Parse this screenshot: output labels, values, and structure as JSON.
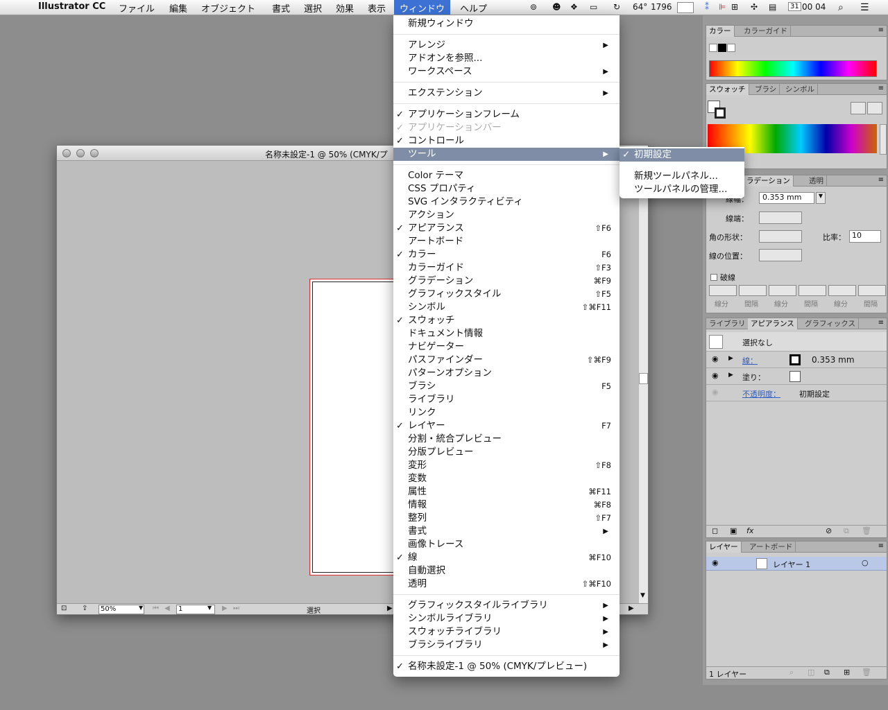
{
  "menubar": {
    "app": "Illustrator CC",
    "menus": [
      "ファイル",
      "編集",
      "オブジェクト",
      "書式",
      "選択",
      "効果",
      "表示",
      "ウィンドウ",
      "ヘルプ"
    ],
    "active_menu": "ウィンドウ",
    "status": {
      "temp": "64°",
      "num": "1796",
      "cal_day": "31",
      "clock": "00 04"
    }
  },
  "document": {
    "title": "名称未設定-1 @ 50% (CMYK/プ",
    "zoom": "50%",
    "page": "1",
    "status_label": "選択"
  },
  "window_menu": {
    "items": [
      {
        "label": "新規ウィンドウ",
        "check": "",
        "shortcut": "",
        "submenu": false,
        "disabled": false
      },
      {
        "sep": true
      },
      {
        "label": "アレンジ",
        "check": "",
        "shortcut": "",
        "submenu": true,
        "disabled": false
      },
      {
        "label": "アドオンを参照...",
        "check": "",
        "shortcut": "",
        "submenu": false,
        "disabled": false
      },
      {
        "label": "ワークスペース",
        "check": "",
        "shortcut": "",
        "submenu": true,
        "disabled": false
      },
      {
        "sep": true
      },
      {
        "label": "エクステンション",
        "check": "",
        "shortcut": "",
        "submenu": true,
        "disabled": false
      },
      {
        "sep": true
      },
      {
        "label": "アプリケーションフレーム",
        "check": "✓",
        "shortcut": "",
        "submenu": false,
        "disabled": false
      },
      {
        "label": "アプリケーションバー",
        "check": "✓",
        "shortcut": "",
        "submenu": false,
        "disabled": true
      },
      {
        "label": "コントロール",
        "check": "✓",
        "shortcut": "",
        "submenu": false,
        "disabled": false
      },
      {
        "label": "ツール",
        "check": "",
        "shortcut": "",
        "submenu": true,
        "disabled": false,
        "highlight": true
      },
      {
        "sep": true
      },
      {
        "label": "Color テーマ",
        "check": "",
        "shortcut": "",
        "submenu": false,
        "disabled": false
      },
      {
        "label": "CSS プロパティ",
        "check": "",
        "shortcut": "",
        "submenu": false,
        "disabled": false
      },
      {
        "label": "SVG インタラクティビティ",
        "check": "",
        "shortcut": "",
        "submenu": false,
        "disabled": false
      },
      {
        "label": "アクション",
        "check": "",
        "shortcut": "",
        "submenu": false,
        "disabled": false
      },
      {
        "label": "アピアランス",
        "check": "✓",
        "shortcut": "⇧F6",
        "submenu": false,
        "disabled": false
      },
      {
        "label": "アートボード",
        "check": "",
        "shortcut": "",
        "submenu": false,
        "disabled": false
      },
      {
        "label": "カラー",
        "check": "✓",
        "shortcut": "F6",
        "submenu": false,
        "disabled": false
      },
      {
        "label": "カラーガイド",
        "check": "",
        "shortcut": "⇧F3",
        "submenu": false,
        "disabled": false
      },
      {
        "label": "グラデーション",
        "check": "",
        "shortcut": "⌘F9",
        "submenu": false,
        "disabled": false
      },
      {
        "label": "グラフィックスタイル",
        "check": "",
        "shortcut": "⇧F5",
        "submenu": false,
        "disabled": false
      },
      {
        "label": "シンボル",
        "check": "",
        "shortcut": "⇧⌘F11",
        "submenu": false,
        "disabled": false
      },
      {
        "label": "スウォッチ",
        "check": "✓",
        "shortcut": "",
        "submenu": false,
        "disabled": false
      },
      {
        "label": "ドキュメント情報",
        "check": "",
        "shortcut": "",
        "submenu": false,
        "disabled": false
      },
      {
        "label": "ナビゲーター",
        "check": "",
        "shortcut": "",
        "submenu": false,
        "disabled": false
      },
      {
        "label": "パスファインダー",
        "check": "",
        "shortcut": "⇧⌘F9",
        "submenu": false,
        "disabled": false
      },
      {
        "label": "パターンオプション",
        "check": "",
        "shortcut": "",
        "submenu": false,
        "disabled": false
      },
      {
        "label": "ブラシ",
        "check": "",
        "shortcut": "F5",
        "submenu": false,
        "disabled": false
      },
      {
        "label": "ライブラリ",
        "check": "",
        "shortcut": "",
        "submenu": false,
        "disabled": false
      },
      {
        "label": "リンク",
        "check": "",
        "shortcut": "",
        "submenu": false,
        "disabled": false
      },
      {
        "label": "レイヤー",
        "check": "✓",
        "shortcut": "F7",
        "submenu": false,
        "disabled": false
      },
      {
        "label": "分割・統合プレビュー",
        "check": "",
        "shortcut": "",
        "submenu": false,
        "disabled": false
      },
      {
        "label": "分版プレビュー",
        "check": "",
        "shortcut": "",
        "submenu": false,
        "disabled": false
      },
      {
        "label": "変形",
        "check": "",
        "shortcut": "⇧F8",
        "submenu": false,
        "disabled": false
      },
      {
        "label": "変数",
        "check": "",
        "shortcut": "",
        "submenu": false,
        "disabled": false
      },
      {
        "label": "属性",
        "check": "",
        "shortcut": "⌘F11",
        "submenu": false,
        "disabled": false
      },
      {
        "label": "情報",
        "check": "",
        "shortcut": "⌘F8",
        "submenu": false,
        "disabled": false
      },
      {
        "label": "整列",
        "check": "",
        "shortcut": "⇧F7",
        "submenu": false,
        "disabled": false
      },
      {
        "label": "書式",
        "check": "",
        "shortcut": "",
        "submenu": true,
        "disabled": false
      },
      {
        "label": "画像トレース",
        "check": "",
        "shortcut": "",
        "submenu": false,
        "disabled": false
      },
      {
        "label": "線",
        "check": "✓",
        "shortcut": "⌘F10",
        "submenu": false,
        "disabled": false
      },
      {
        "label": "自動選択",
        "check": "",
        "shortcut": "",
        "submenu": false,
        "disabled": false
      },
      {
        "label": "透明",
        "check": "",
        "shortcut": "⇧⌘F10",
        "submenu": false,
        "disabled": false
      },
      {
        "sep": true
      },
      {
        "label": "グラフィックスタイルライブラリ",
        "check": "",
        "shortcut": "",
        "submenu": true,
        "disabled": false
      },
      {
        "label": "シンボルライブラリ",
        "check": "",
        "shortcut": "",
        "submenu": true,
        "disabled": false
      },
      {
        "label": "スウォッチライブラリ",
        "check": "",
        "shortcut": "",
        "submenu": true,
        "disabled": false
      },
      {
        "label": "ブラシライブラリ",
        "check": "",
        "shortcut": "",
        "submenu": true,
        "disabled": false
      },
      {
        "sep": true
      },
      {
        "label": "名称未設定-1 @ 50% (CMYK/プレビュー)",
        "check": "✓",
        "shortcut": "",
        "submenu": false,
        "disabled": false
      }
    ]
  },
  "tools_submenu": {
    "items": [
      {
        "label": "初期設定",
        "check": "✓",
        "highlight": true
      },
      {
        "label": "新規ツールパネル...",
        "check": ""
      },
      {
        "label": "ツールパネルの管理...",
        "check": ""
      }
    ]
  },
  "panels": {
    "color": {
      "tabs": [
        "カラー",
        "カラーガイド"
      ]
    },
    "swatches": {
      "tabs": [
        "スウォッチ",
        "ブラシ",
        "シンボル"
      ]
    },
    "stroke": {
      "tabs": [
        "ラデーション",
        "透明"
      ],
      "weight_label": "線幅：",
      "weight": "0.353 mm",
      "cap_label": "線端：",
      "corner_label": "角の形状：",
      "ratio_label": "比率：",
      "ratio": "10",
      "align_label": "線の位置：",
      "dashed_label": "破線",
      "dash_labels": [
        "線分",
        "間隔",
        "線分",
        "間隔",
        "線分",
        "間隔"
      ]
    },
    "appearance": {
      "tabs": [
        "ライブラリ",
        "アピアランス",
        "グラフィックス"
      ],
      "header": "選択なし",
      "stroke_label": "線：",
      "stroke_value": "0.353 mm",
      "fill_label": "塗り：",
      "opacity_label": "不透明度：",
      "opacity_value": "初期設定"
    },
    "layers": {
      "tabs": [
        "レイヤー",
        "アートボード"
      ],
      "layer_name": "レイヤー 1",
      "footer": "1 レイヤー"
    }
  },
  "colors": {
    "accent": "#3d72d4",
    "menu_highlight": "#7f8ea6",
    "artboard_border": "#e03030"
  }
}
